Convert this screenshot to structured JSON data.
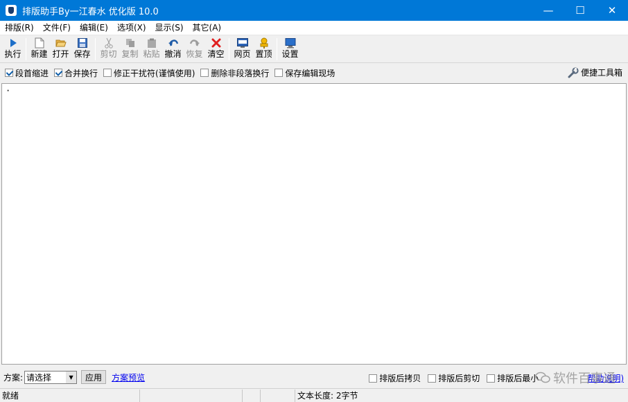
{
  "window": {
    "title": "排版助手By一江春水 优化版 10.0",
    "minimize": "—",
    "maximize": "☐",
    "close": "✕"
  },
  "menu": [
    "排版(R)",
    "文件(F)",
    "编辑(E)",
    "选项(X)",
    "显示(S)",
    "其它(A)"
  ],
  "toolbar": {
    "run": "执行",
    "new": "新建",
    "open": "打开",
    "save": "保存",
    "cut": "剪切",
    "copy": "复制",
    "paste": "粘贴",
    "undo": "撤消",
    "redo": "恢复",
    "clear": "清空",
    "web": "网页",
    "top": "置顶",
    "settings": "设置"
  },
  "options": {
    "indent": {
      "label": "段首缩进",
      "checked": true
    },
    "merge": {
      "label": "合并换行",
      "checked": true
    },
    "fix": {
      "label": "修正干扰符(谨慎使用)",
      "checked": false
    },
    "delete_breaks": {
      "label": "删除非段落换行",
      "checked": false
    },
    "keep_scene": {
      "label": "保存编辑现场",
      "checked": false
    },
    "tools": "便捷工具箱"
  },
  "editor": {
    "content": "·"
  },
  "scheme": {
    "label": "方案:",
    "selected": "请选择",
    "apply": "应用",
    "preview": "方案预览",
    "after_copy": "排版后拷贝",
    "after_cut": "排版后剪切",
    "after_min": "排版后最小",
    "help_suffix": "帮助说明)"
  },
  "watermark": "软件百事通",
  "status": {
    "ready": "就绪",
    "length": "文本长度: 2字节"
  },
  "colors": {
    "titlebar": "#0078d7",
    "link": "#0000ee"
  }
}
